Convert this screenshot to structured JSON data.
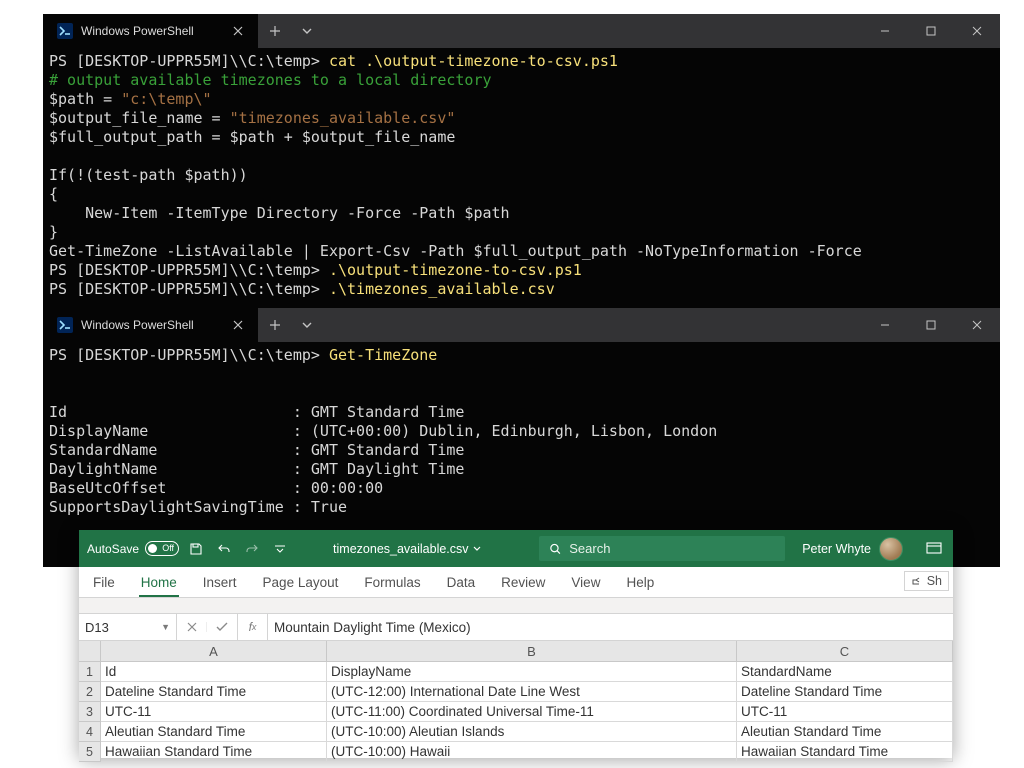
{
  "term1": {
    "tab_title": "Windows PowerShell",
    "lines": [
      [
        {
          "t": "PS [DESKTOP-UPPR55M]\\\\C:\\temp> ",
          "c": "prompt"
        },
        {
          "t": "cat ",
          "c": "cmd"
        },
        {
          "t": ".\\output-timezone-to-csv.ps1",
          "c": "cmd"
        }
      ],
      [
        {
          "t": "# output available timezones to a local directory",
          "c": "comment"
        }
      ],
      [
        {
          "t": "$path = ",
          "c": "keyword"
        },
        {
          "t": "\"c:\\temp\\\"",
          "c": "string"
        }
      ],
      [
        {
          "t": "$output_file_name = ",
          "c": "keyword"
        },
        {
          "t": "\"timezones_available.csv\"",
          "c": "string"
        }
      ],
      [
        {
          "t": "$full_output_path = $path + $output_file_name",
          "c": "keyword"
        }
      ],
      [
        {
          "t": "",
          "c": "keyword"
        }
      ],
      [
        {
          "t": "If(!(test-path $path))",
          "c": "keyword"
        }
      ],
      [
        {
          "t": "{",
          "c": "keyword"
        }
      ],
      [
        {
          "t": "    New-Item -ItemType Directory -Force -Path $path",
          "c": "keyword"
        }
      ],
      [
        {
          "t": "}",
          "c": "keyword"
        }
      ],
      [
        {
          "t": "Get-TimeZone -ListAvailable | Export-Csv -Path $full_output_path -NoTypeInformation -Force",
          "c": "keyword"
        }
      ],
      [
        {
          "t": "PS [DESKTOP-UPPR55M]\\\\C:\\temp> ",
          "c": "prompt"
        },
        {
          "t": ".\\output-timezone-to-csv.ps1",
          "c": "cmd"
        }
      ],
      [
        {
          "t": "PS [DESKTOP-UPPR55M]\\\\C:\\temp> ",
          "c": "prompt"
        },
        {
          "t": ".\\timezones_available.csv",
          "c": "cmd"
        }
      ]
    ]
  },
  "term2": {
    "tab_title": "Windows PowerShell",
    "lines": [
      [
        {
          "t": "PS [DESKTOP-UPPR55M]\\\\C:\\temp> ",
          "c": "prompt"
        },
        {
          "t": "Get-TimeZone",
          "c": "cmd"
        }
      ],
      [
        {
          "t": "",
          "c": ""
        }
      ],
      [
        {
          "t": "",
          "c": ""
        }
      ],
      [
        {
          "t": "Id                         : GMT Standard Time",
          "c": "keyword"
        }
      ],
      [
        {
          "t": "DisplayName                : (UTC+00:00) Dublin, Edinburgh, Lisbon, London",
          "c": "keyword"
        }
      ],
      [
        {
          "t": "StandardName               : GMT Standard Time",
          "c": "keyword"
        }
      ],
      [
        {
          "t": "DaylightName               : GMT Daylight Time",
          "c": "keyword"
        }
      ],
      [
        {
          "t": "BaseUtcOffset              : 00:00:00",
          "c": "keyword"
        }
      ],
      [
        {
          "t": "SupportsDaylightSavingTime : True",
          "c": "keyword"
        }
      ]
    ]
  },
  "excel": {
    "autosave_label": "AutoSave",
    "autosave_state": "Off",
    "filename": "timezones_available.csv",
    "search_placeholder": "Search",
    "user_name": "Peter Whyte",
    "ribbon": [
      "File",
      "Home",
      "Insert",
      "Page Layout",
      "Formulas",
      "Data",
      "Review",
      "View",
      "Help"
    ],
    "share_label": "Sh",
    "namebox": "D13",
    "fx_value": "Mountain Daylight Time (Mexico)",
    "columns": [
      "A",
      "B",
      "C"
    ],
    "rows": [
      {
        "n": "1",
        "a": "Id",
        "b": "DisplayName",
        "c": "StandardName"
      },
      {
        "n": "2",
        "a": "Dateline Standard Time",
        "b": "(UTC-12:00) International Date Line West",
        "c": "Dateline Standard Time"
      },
      {
        "n": "3",
        "a": "UTC-11",
        "b": "(UTC-11:00) Coordinated Universal Time-11",
        "c": "UTC-11"
      },
      {
        "n": "4",
        "a": "Aleutian Standard Time",
        "b": "(UTC-10:00) Aleutian Islands",
        "c": "Aleutian Standard Time"
      },
      {
        "n": "5",
        "a": "Hawaiian Standard Time",
        "b": "(UTC-10:00) Hawaii",
        "c": "Hawaiian Standard Time"
      }
    ]
  }
}
